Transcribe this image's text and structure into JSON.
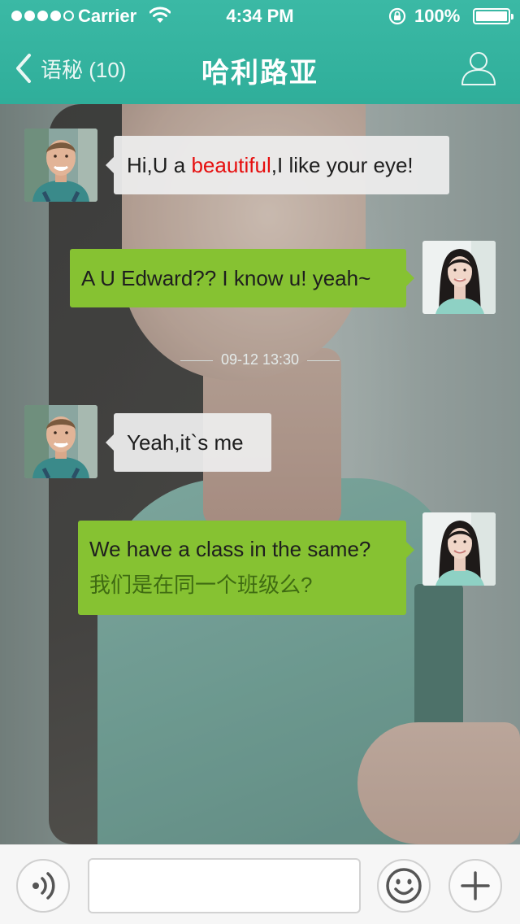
{
  "status_bar": {
    "carrier": "Carrier",
    "time": "4:34 PM",
    "battery": "100%",
    "battery_level": 1.0,
    "signal_bars_filled": 4,
    "signal_bars_total": 5
  },
  "nav": {
    "back_label": "语秘 (10)",
    "title": "哈利路亚",
    "profile_icon": "person-outline-icon"
  },
  "colors": {
    "nav_bar": "#35b4a0",
    "outgoing_bubble": "#86c232",
    "incoming_bubble": "#ececec",
    "highlight": "#e60e0e"
  },
  "messages": [
    {
      "direction": "in",
      "sender_avatar": "edward-avatar",
      "text_before": "Hi,U a ",
      "highlight": "beautiful",
      "text_after": ",I like your eye!"
    },
    {
      "direction": "out",
      "sender_avatar": "girl-avatar",
      "text": "A U Edward?? I know u! yeah~"
    },
    {
      "direction": "in",
      "sender_avatar": "edward-avatar",
      "text": "Yeah,it`s me"
    },
    {
      "direction": "out",
      "sender_avatar": "girl-avatar",
      "text": "We have a class in the same?",
      "translation": "我们是在同一个班级么?"
    }
  ],
  "timestamp": "09-12 13:30",
  "input_bar": {
    "voice_icon": "voice-icon",
    "text_value": "",
    "emoji_icon": "smiley-icon",
    "plus_icon": "plus-icon"
  }
}
